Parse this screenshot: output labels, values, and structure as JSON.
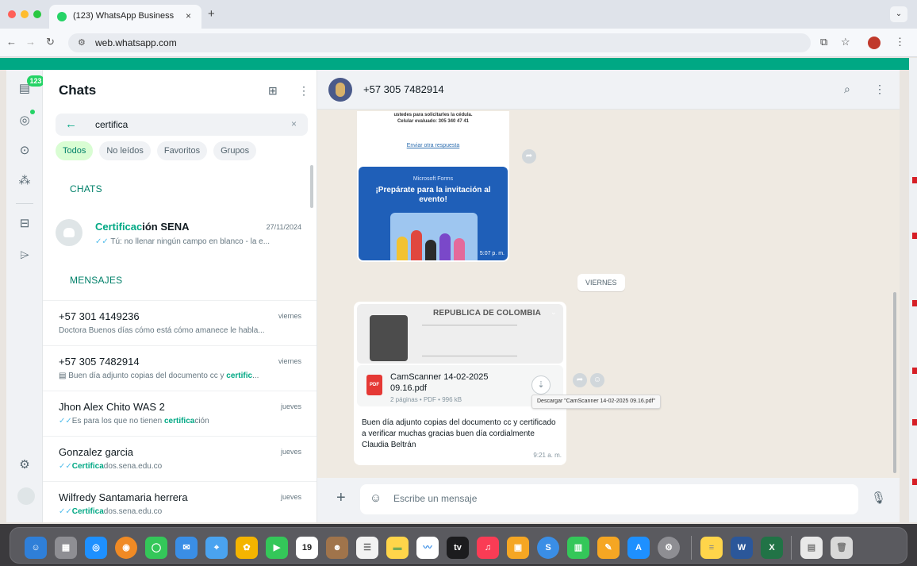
{
  "browser": {
    "tab_title": "(123) WhatsApp Business",
    "tab_close": "×",
    "new_tab": "+",
    "url": "web.whatsapp.com",
    "menu_chevron": "⌄"
  },
  "rail": {
    "badge": "123"
  },
  "chat_list": {
    "title": "Chats",
    "search": {
      "value": "certifica",
      "clear": "×"
    },
    "filters": [
      "Todos",
      "No leídos",
      "Favoritos",
      "Grupos"
    ],
    "section_chats": "CHATS",
    "section_messages": "MENSAJES",
    "chat_results": [
      {
        "name_highlight": "Certificac",
        "name_rest": "ión SENA",
        "date": "27/11/2024",
        "preview": "Tú: no llenar ningún campo en blanco - la e..."
      }
    ],
    "message_results": [
      {
        "name": "+57 301 4149236",
        "date": "viernes",
        "preview": "Doctora Buenos días cómo está cómo amanece le habla..."
      },
      {
        "name": "+57 305 7482914",
        "date": "viernes",
        "preview_prefix": "Buen día adjunto copias del documento cc y ",
        "preview_highlight": "certific",
        "preview_suffix": "..."
      },
      {
        "name": "Jhon Alex Chito WAS 2",
        "date": "jueves",
        "preview_prefix": "Es para los que no tienen ",
        "preview_highlight": "certifica",
        "preview_suffix": "ción"
      },
      {
        "name": "Gonzalez garcia",
        "date": "jueves",
        "preview_highlight": "Certifica",
        "preview_suffix": "dos.sena.edu.co"
      },
      {
        "name": "Wilfredy Santamaria herrera",
        "date": "jueves",
        "preview_highlight": "Certifica",
        "preview_suffix": "dos.sena.edu.co"
      }
    ]
  },
  "conversation": {
    "contact": "+57 305 7482914",
    "card_message": {
      "line1": "ustedes para solicitarles la cédula.",
      "line2": "Celular evaluado: 305 340 47 41",
      "link": "Enviar otra respuesta",
      "image_label": "Microsoft Forms",
      "image_title": "¡Prepárate para la invitación al evento!",
      "time": "5:07 p. m."
    },
    "day_divider": "VIERNES",
    "document_message": {
      "id_title": "REPUBLICA DE COLOMBIA",
      "file_name": "CamScanner 14-02-2025 09.16.pdf",
      "file_meta": "2 páginas • PDF • 996 kB",
      "pdf_label": "PDF",
      "caption": "Buen día adjunto copias del documento cc y certificado a verificar muchas gracias buen día cordialmente Claudia Beltrán",
      "time": "9:21 a. m.",
      "tooltip": "Descargar \"CamScanner 14-02-2025 09.16.pdf\""
    },
    "composer_placeholder": "Escribe un mensaje"
  },
  "dock": {
    "calendar_day": "19",
    "tv_label": "tv"
  },
  "colors": {
    "accent": "#00a884",
    "highlight": "#00a884",
    "read_tick": "#53bdeb",
    "pdf_red": "#e53935"
  }
}
